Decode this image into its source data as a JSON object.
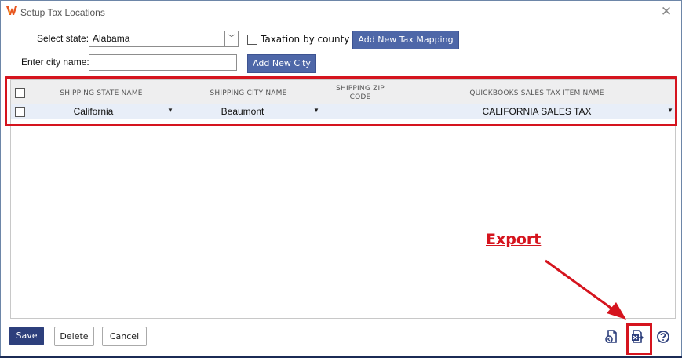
{
  "window": {
    "title": "Setup Tax Locations"
  },
  "form": {
    "select_state_label": "Select state:",
    "select_state_value": "Alabama",
    "taxation_by_county_label": "Taxation by county",
    "add_tax_mapping_label": "Add New Tax Mapping",
    "city_name_label": "Enter city name:",
    "city_name_value": "",
    "add_city_label": "Add New City"
  },
  "grid": {
    "columns": [
      "SHIPPING STATE NAME",
      "SHIPPING CITY NAME",
      "SHIPPING ZIP CODE",
      "QUICKBOOKS SALES TAX ITEM NAME"
    ],
    "zip_header_line1": "SHIPPING ZIP",
    "zip_header_line2": "CODE",
    "rows": [
      {
        "state": "California",
        "city": "Beaumont",
        "zip": "",
        "tax_item": "CALIFORNIA SALES TAX"
      }
    ]
  },
  "annotation": {
    "export_label": "Export"
  },
  "footer": {
    "save_label": "Save",
    "delete_label": "Delete",
    "cancel_label": "Cancel"
  },
  "icons": {
    "app": "w-logo-icon",
    "close": "close-icon",
    "import": "import-file-icon",
    "export": "export-excel-icon",
    "help": "help-icon"
  },
  "colors": {
    "primary_button": "#4e67a8",
    "save_button": "#2d3f7c",
    "annotation_red": "#d5141e",
    "selected_row": "#e8eef8"
  }
}
